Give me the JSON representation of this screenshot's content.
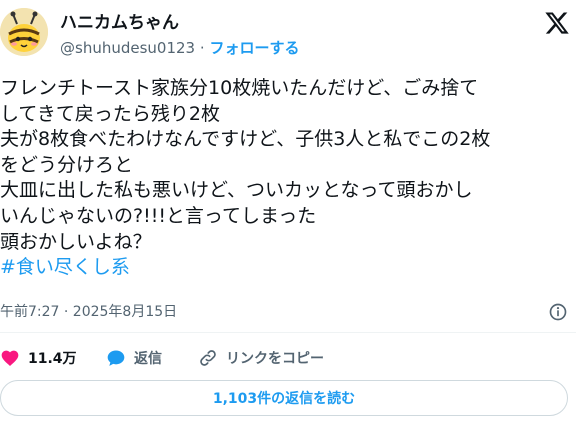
{
  "author": {
    "display_name": "ハニカムちゃん",
    "handle": "@shuhudesu0123",
    "separator": "·",
    "follow_label": "フォローする",
    "avatar_icon": "bee-character-icon"
  },
  "tweet": {
    "lines": [
      "フレンチトースト家族分10枚焼いたんだけど、ごみ捨て",
      "してきて戻ったら残り2枚",
      "夫が8枚食べたわけなんですけど、子供3人と私でこの2枚",
      "をどう分けろと",
      "大皿に出した私も悪いけど、ついカッとなって頭おかし",
      "いんじゃないの?!!!と言ってしまった",
      "頭おかしいよね？"
    ],
    "hashtag": "#食い尽くし系"
  },
  "meta": {
    "timestamp": "午前7:27 · 2025年8月15日"
  },
  "actions": {
    "likes_count": "11.4万",
    "reply_label": "返信",
    "copy_link_label": "リンクをコピー"
  },
  "read_replies_label": "1,103件の返信を読む",
  "colors": {
    "accent": "#1d9bf0",
    "like": "#f91880",
    "text": "#0f1419",
    "secondary": "#536471"
  }
}
